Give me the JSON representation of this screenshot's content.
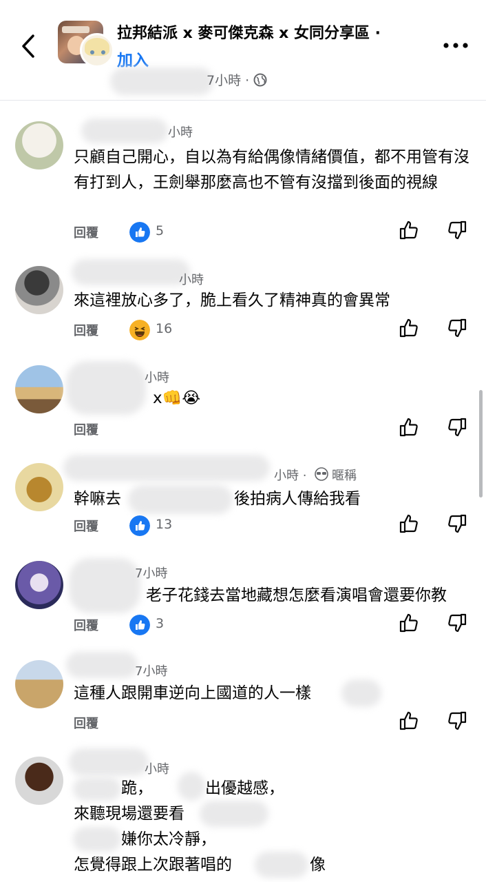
{
  "header": {
    "group_title": "拉邦結派 x 麥可傑克森 x 女同分享區 ·",
    "join_label": "加入",
    "post_time": "7小時 ·"
  },
  "labels": {
    "reply": "回覆"
  },
  "comments": [
    {
      "time": "小時",
      "text": "只顧自己開心，自以為有給偶像情緒價值，都不用管有沒有打到人，王劍舉那麼高也不管有沒擋到後面的視線",
      "reaction": "like",
      "count": "5"
    },
    {
      "time": "小時",
      "text": "來這裡放心多了，脆上看久了精神真的會異常",
      "reaction": "haha",
      "count": "16"
    },
    {
      "time": "小時",
      "text": "x👊😭",
      "reaction": "",
      "count": ""
    },
    {
      "time": "小時 ·",
      "badge": "暱稱",
      "text": "幹嘛去",
      "text2": "後拍病人傳給我看",
      "reaction": "like",
      "count": "13"
    },
    {
      "time": "7小時",
      "text": "老子花錢去當地藏想怎麼看演唱會還要你教",
      "reaction": "like",
      "count": "3"
    },
    {
      "time": "7小時",
      "text": "這種人跟開車逆向上國道的人一樣",
      "reaction": "",
      "count": ""
    },
    {
      "time": "小時",
      "lines": [
        "跪，",
        "出優越感，",
        "來聽現場還要看",
        "嫌你太冷靜，",
        "怎覺得跟上次跟著唱的",
        "像"
      ]
    }
  ],
  "colors": {
    "accent": "#1877f2",
    "secondary_text": "#65676b",
    "haha": "#f7b125"
  }
}
